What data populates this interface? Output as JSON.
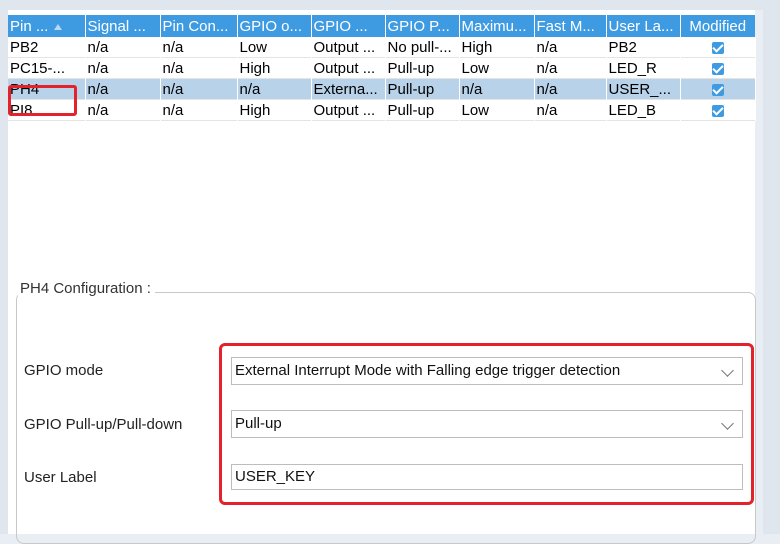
{
  "table": {
    "headers": [
      "Pin ...",
      "Signal ...",
      "Pin Con...",
      "GPIO o...",
      "GPIO ...",
      "GPIO P...",
      "Maximu...",
      "Fast M...",
      "User La...",
      "Modified"
    ],
    "rows": [
      [
        "PB2",
        "n/a",
        "n/a",
        "Low",
        "Output ...",
        "No pull-...",
        "High",
        "n/a",
        "PB2",
        true
      ],
      [
        "PC15-...",
        "n/a",
        "n/a",
        "High",
        "Output ...",
        "Pull-up",
        "Low",
        "n/a",
        "LED_R",
        true
      ],
      [
        "PH4",
        "n/a",
        "n/a",
        "n/a",
        "Externa...",
        "Pull-up",
        "n/a",
        "n/a",
        "USER_...",
        true
      ],
      [
        "PI8",
        "n/a",
        "n/a",
        "High",
        "Output ...",
        "Pull-up",
        "Low",
        "n/a",
        "LED_B",
        true
      ]
    ],
    "selected_row": 2
  },
  "config": {
    "title": "PH4 Configuration :",
    "gpio_mode_label": "GPIO mode",
    "gpio_mode_value": "External Interrupt Mode with Falling edge trigger detection",
    "pull_label": "GPIO Pull-up/Pull-down",
    "pull_value": "Pull-up",
    "user_label_label": "User Label",
    "user_label_value": "USER_KEY"
  },
  "colors": {
    "header_bg": "#3f9be1",
    "selected_row_bg": "#b8d2ea",
    "highlight_red": "#e3222b"
  },
  "icons": {
    "sort": "sort-ascending-icon",
    "checkbox": "checked-checkbox-icon",
    "dropdown": "chevron-down-icon"
  }
}
